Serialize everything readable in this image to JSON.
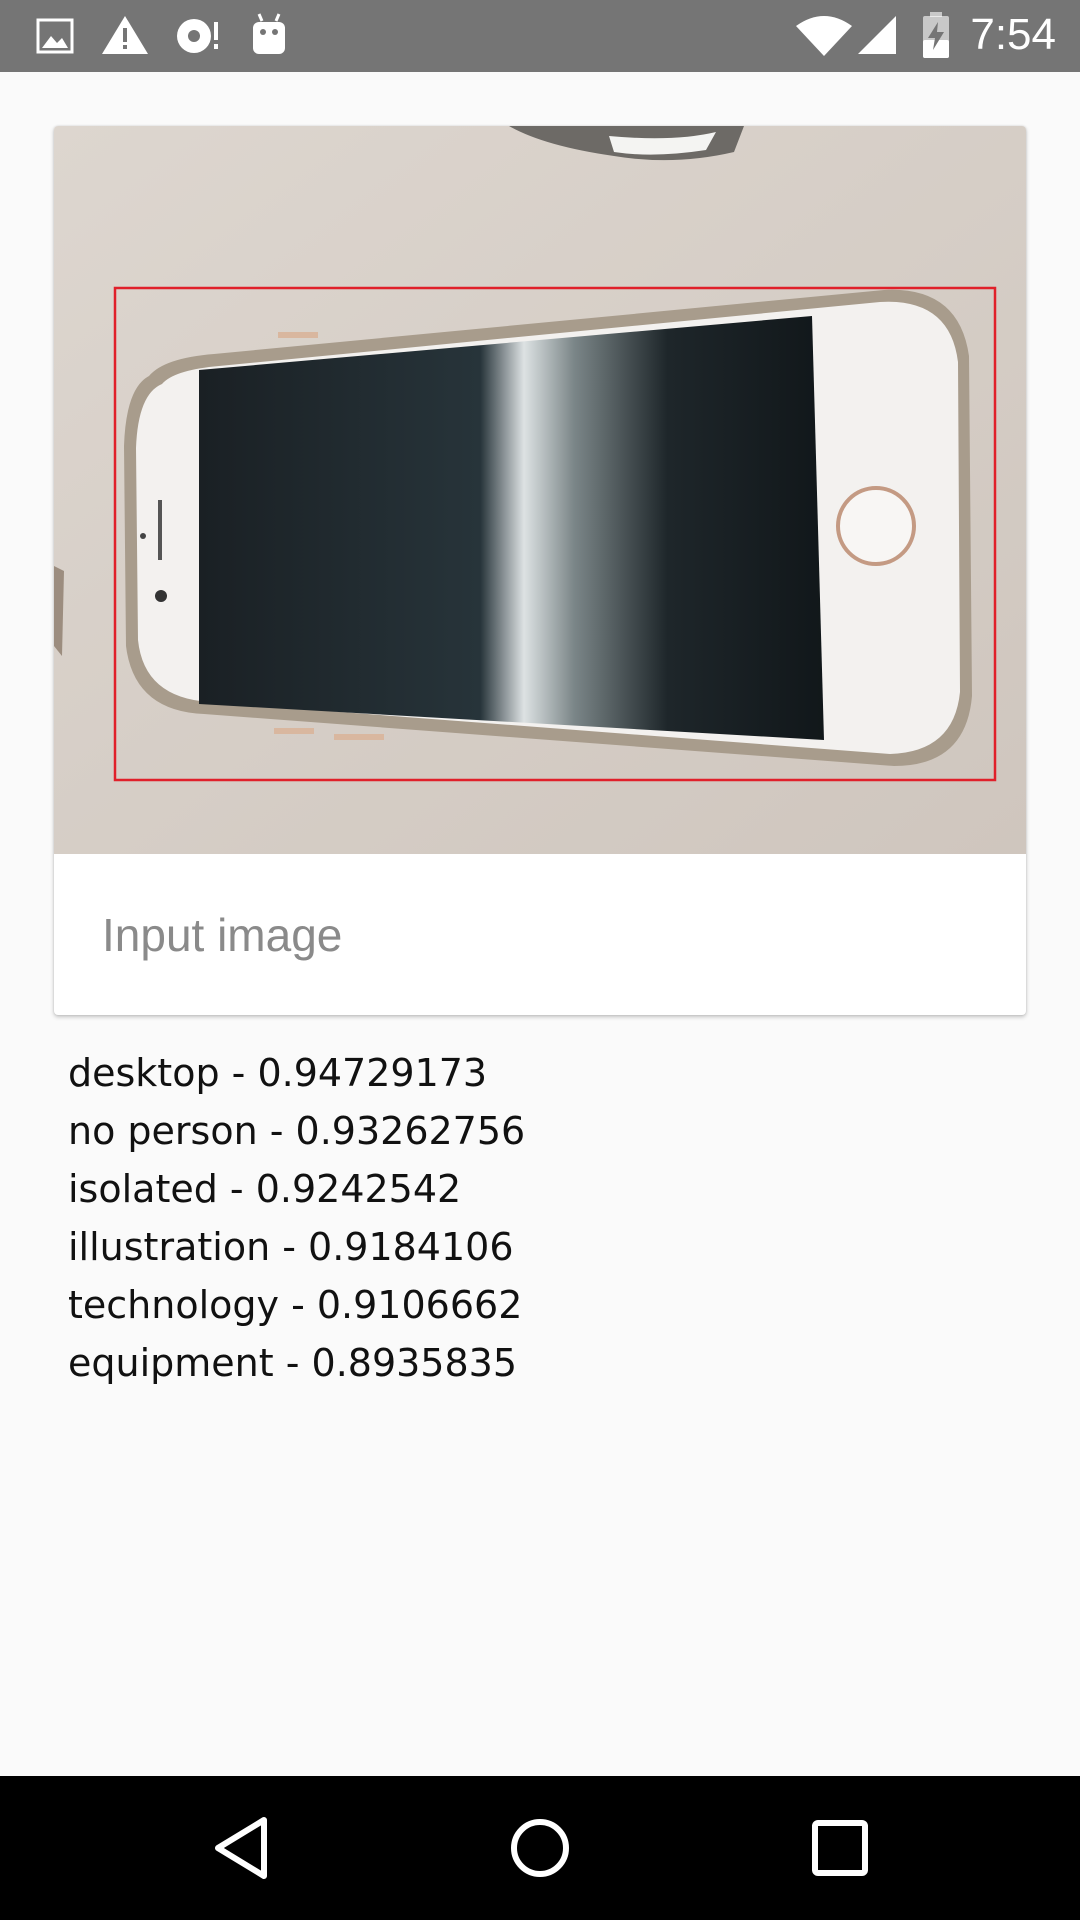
{
  "status_bar": {
    "time": "7:54",
    "left_icons": [
      "image-icon",
      "warning-icon",
      "sync-disc-icon",
      "android-icon"
    ],
    "right_icons": [
      "wifi-icon",
      "cell-signal-icon",
      "battery-charging-icon"
    ]
  },
  "card": {
    "image_subject": "smartphone",
    "caption": "Input image",
    "detection_box_color": "#e0202a"
  },
  "results": [
    {
      "text": "desktop - 0.94729173"
    },
    {
      "text": "no person - 0.93262756"
    },
    {
      "text": "isolated - 0.9242542"
    },
    {
      "text": "illustration - 0.9184106"
    },
    {
      "text": "technology - 0.9106662"
    },
    {
      "text": "equipment - 0.8935835"
    }
  ],
  "nav_bar": {
    "buttons": [
      "back-icon",
      "home-icon",
      "recents-icon"
    ]
  }
}
